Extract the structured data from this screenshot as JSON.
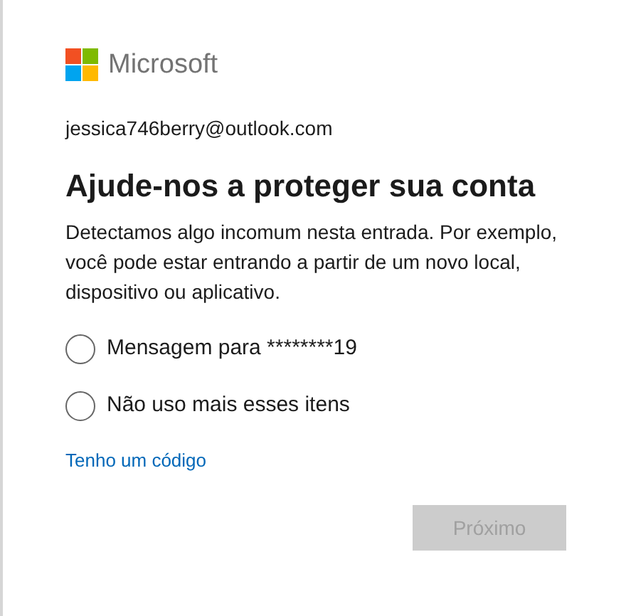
{
  "logo": {
    "text": "Microsoft"
  },
  "account": "jessica746berry@outlook.com",
  "title": "Ajude-nos a proteger sua conta",
  "description": "Detectamos algo incomum nesta entrada. Por exemplo, você pode estar entrando a partir de um novo local, dispositivo ou aplicativo.",
  "options": [
    {
      "label": "Mensagem para ********19",
      "selected": false
    },
    {
      "label": "Não uso mais esses itens",
      "selected": false
    }
  ],
  "link": "Tenho um código",
  "next_button": {
    "label": "Próximo",
    "disabled": true
  }
}
